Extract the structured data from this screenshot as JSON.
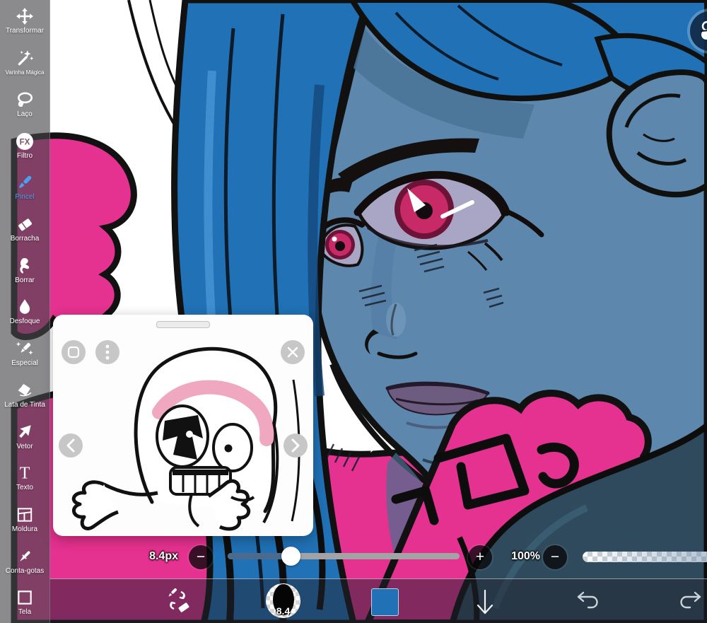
{
  "colors": {
    "accent_selected_tool": "#4aa0f5",
    "canvas_pink": "#e5318f",
    "canvas_blue": "#2071b5",
    "skin_blue": "#5d87ad",
    "shoulder_teal": "#2e4a5c",
    "iris_red": "#bd2460",
    "current_color_swatch": "#2071b5"
  },
  "sidebar": {
    "items": [
      {
        "label": "Transformar",
        "icon": "move",
        "selected": false
      },
      {
        "label": "Varinha Mágica",
        "icon": "magic-wand",
        "selected": false
      },
      {
        "label": "Laço",
        "icon": "lasso",
        "selected": false
      },
      {
        "label": "Filtro",
        "icon": "fx-filter",
        "icon_text": "FX",
        "selected": false
      },
      {
        "label": "Pincel",
        "icon": "brush",
        "selected": true
      },
      {
        "label": "Borracha",
        "icon": "eraser",
        "selected": false
      },
      {
        "label": "Borrar",
        "icon": "smudge-finger",
        "selected": false
      },
      {
        "label": "Desfoque",
        "icon": "blur-drop",
        "selected": false
      },
      {
        "label": "Especial",
        "icon": "special-pencil",
        "selected": false
      },
      {
        "label": "Lata de Tinta",
        "icon": "paint-bucket",
        "selected": false
      },
      {
        "label": "Vetor",
        "icon": "vector-cursor",
        "selected": false
      },
      {
        "label": "Texto",
        "icon": "text",
        "icon_text": "T",
        "selected": false
      },
      {
        "label": "Moldura",
        "icon": "frame",
        "selected": false
      },
      {
        "label": "Conta-gotas",
        "icon": "eyedropper",
        "selected": false
      },
      {
        "label": "Tela",
        "icon": "canvas",
        "selected": false
      }
    ]
  },
  "reference_panel": {
    "buttons": [
      "minimize",
      "more-options",
      "close",
      "previous",
      "next"
    ]
  },
  "brush_controls": {
    "size_label": "8.4px",
    "size_minus_glyph": "−",
    "size_plus_glyph": "+",
    "opacity_label": "100%",
    "opacity_minus_glyph": "−"
  },
  "bottom_bar": {
    "brush_size_badge": "8.4"
  }
}
